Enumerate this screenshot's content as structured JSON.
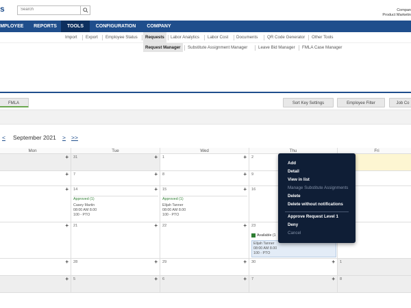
{
  "header": {
    "logo_fragment": "s",
    "search_placeholder": "Search",
    "company_line1": "Compan",
    "company_line2": "Product Marketin"
  },
  "nav": {
    "items": [
      "EMPLOYEE",
      "REPORTS",
      "TOOLS",
      "CONFIGURATION",
      "COMPANY"
    ],
    "active": "TOOLS"
  },
  "subnav": {
    "items": [
      "Import",
      "Export",
      "Employee Status",
      "Requests",
      "Labor Analytics",
      "Labor Cost",
      "Documents",
      "QR Code Generator",
      "Other Tools"
    ],
    "active": "Requests"
  },
  "subnav2": {
    "items": [
      "Request Manager",
      "Substitute Assignment Manager",
      "Leave Bid Manager",
      "FMLA Case Manager"
    ],
    "active": "Request Manager"
  },
  "toolbar": {
    "fmla": "FMLA",
    "sort_key": "Sort Key Settings",
    "employee_filter": "Employee Filter",
    "job_code": "Job Co"
  },
  "calendar": {
    "prev": "<",
    "title": "September 2021",
    "next": ">",
    "next_fast": ">>",
    "days": [
      "Mon",
      "Tue",
      "Wed",
      "Thu",
      "Fri"
    ],
    "weeks": [
      [
        "",
        "31",
        "1",
        "2",
        ""
      ],
      [
        "",
        "7",
        "8",
        "9",
        ""
      ],
      [
        "",
        "14",
        "15",
        "16",
        ""
      ],
      [
        "",
        "21",
        "22",
        "23",
        ""
      ],
      [
        "",
        "28",
        "29",
        "30",
        "1"
      ],
      [
        "",
        "5",
        "6",
        "7",
        "8"
      ]
    ],
    "events": {
      "tue14": {
        "title": "Approved (1)",
        "name": "Casey Martin",
        "time": "08:00 AM 8.00",
        "code": "100 - PTO"
      },
      "wed15": {
        "title": "Approved (1)",
        "name": "Elijah Tanner",
        "time": "08:00 AM 8.00",
        "code": "100 - PTO"
      },
      "thu23": {
        "title": "Available (1",
        "name": "Elijah Tanner",
        "time": "08:00 AM 8.00",
        "code": "100 - PTO"
      }
    }
  },
  "context_menu": {
    "add": "Add",
    "detail": "Detail",
    "view_in_list": "View in list",
    "manage_substitute": "Manage Substitute Assignments",
    "delete": "Delete",
    "delete_without_notifications": "Delete without notifications",
    "approve_level1": "Approve Request Level 1",
    "deny": "Deny",
    "cancel": "Cancel"
  },
  "colors": {
    "brand_blue": "#1f4e8c",
    "nav_active": "#0d2f5e",
    "menu_bg": "#0f1e36",
    "approved_green": "#2e7d32"
  }
}
